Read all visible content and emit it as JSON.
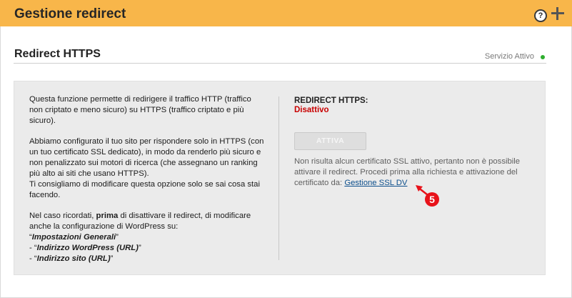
{
  "header": {
    "title": "Gestione redirect",
    "help_label": "?"
  },
  "section": {
    "title": "Redirect HTTPS",
    "service_status": "Servizio Attivo"
  },
  "info": {
    "p1": "Questa funzione permette di redirigere il traffico HTTP (traffico non criptato e meno sicuro) su HTTPS (traffico criptato e più sicuro).",
    "p2_line1": "Abbiamo configurato il tuo sito per rispondere solo in HTTPS (con un tuo certificato SSL dedicato), in modo da renderlo più sicuro e non penalizzato sui motori di ricerca (che assegnano un ranking più alto ai siti che usano HTTPS).",
    "p2_line2": "Ti consigliamo di modificare questa opzione solo se sai cosa stai facendo.",
    "p3_before": "Nel caso ricordati, ",
    "p3_bold": "prima",
    "p3_after": " di disattivare il redirect, di modificare anche la configurazione di WordPress su:",
    "item1": "Impostazioni Generali",
    "item2": "Indirizzo WordPress (URL)",
    "item3": "Indirizzo sito (URL)"
  },
  "status": {
    "label": "REDIRECT HTTPS:",
    "value": "Disattivo",
    "button_label": "ATTIVA",
    "note": "Non risulta alcun certificato SSL attivo, pertanto non è possibile attivare il redirect. Procedi prima alla richiesta e attivazione del certificato da: ",
    "link": "Gestione SSL DV"
  },
  "annotation": {
    "number": "5"
  },
  "colors": {
    "header": "#f8b64a",
    "status_off": "#c80000",
    "link": "#0d4f8c",
    "marker": "#e8121a",
    "active_dot": "#2fae2f"
  }
}
